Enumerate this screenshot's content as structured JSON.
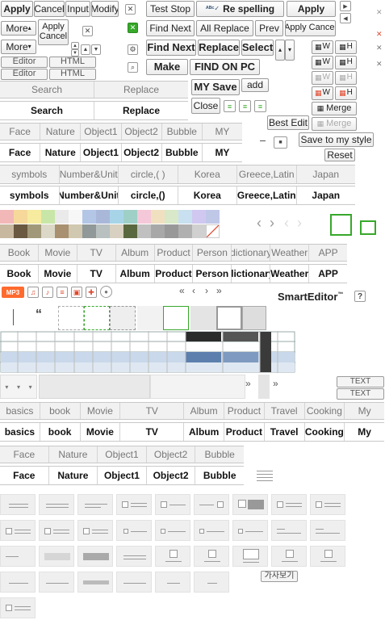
{
  "toolbar1": {
    "apply": "Apply",
    "cancel": "Cancel",
    "input": "Input",
    "modify": "Modify",
    "more": "More",
    "apply_cancel": "Apply\nCancel",
    "more2": "More",
    "editor1": "Editor",
    "html1": "HTML",
    "editor2": "Editor",
    "html2": "HTML"
  },
  "find": {
    "test_stop": "Test Stop",
    "re_spelling": "Re spelling",
    "apply": "Apply",
    "find_next": "Find Next",
    "all_replace": "All Replace",
    "prev": "Prev",
    "apply_cancel": "Apply Cancel",
    "find_next_bold": "Find Next",
    "replace": "Replace",
    "select": "Select",
    "make": "Make",
    "find_on_pc": "FIND ON PC",
    "my_save": "MY Save",
    "add": "add",
    "close": "Close"
  },
  "table_tools": {
    "w": "W",
    "h": "H",
    "merge": "Merge",
    "merge2": "Merge"
  },
  "search_replace_tabs": {
    "top": [
      "Search",
      "Replace"
    ],
    "bottom": [
      "Search",
      "Replace"
    ]
  },
  "side_buttons": {
    "best_edit": "Best Edit",
    "save_style": "Save to my style",
    "reset": "Reset"
  },
  "category_tabs_1": {
    "top": [
      "Face",
      "Nature",
      "Object1",
      "Object2",
      "Bubble",
      "MY"
    ],
    "bottom": [
      "Face",
      "Nature",
      "Object1",
      "Object2",
      "Bubble",
      "MY"
    ]
  },
  "symbol_tabs": {
    "top": [
      "symbols",
      "Number&Unit",
      "circle,( )",
      "Korea",
      "Greece,Latin",
      "Japan"
    ],
    "bottom": [
      "symbols",
      "Number&Unit",
      "circle,()",
      "Korea",
      "Greece,Latin",
      "Japan"
    ]
  },
  "media_tabs": {
    "top": [
      "Book",
      "Movie",
      "TV",
      "Album",
      "Product",
      "Person",
      "dictionary",
      "Weather",
      "APP"
    ],
    "bottom": [
      "Book",
      "Movie",
      "TV",
      "Album",
      "Product",
      "Person",
      "dictionary",
      "Weather",
      "APP"
    ]
  },
  "media_icons": [
    "mp3-icon",
    "headphone-icon",
    "music-note-icon",
    "list-icon",
    "calendar-icon",
    "plus-icon",
    "disc-icon"
  ],
  "pager": {
    "first": "«",
    "prev": "‹",
    "next": "›",
    "last": "»"
  },
  "brand": {
    "name": "SmartEditor",
    "tm": "™",
    "help": "?"
  },
  "quote_glyph": "“",
  "text_labels": {
    "text1": "TEXT",
    "text2": "TEXT"
  },
  "nav_glyphs": {
    "dbl1": "»",
    "dbl2": "»"
  },
  "shop_tabs": {
    "top": [
      "basics",
      "book",
      "Movie",
      "TV",
      "Album",
      "Product",
      "Travel",
      "Cooking",
      "My"
    ],
    "bottom": [
      "basics",
      "book",
      "Movie",
      "TV",
      "Album",
      "Product",
      "Travel",
      "Cooking",
      "My"
    ]
  },
  "category_tabs_2": {
    "top": [
      "Face",
      "Nature",
      "Object1",
      "Object2",
      "Bubble"
    ],
    "bottom": [
      "Face",
      "Nature",
      "Object1",
      "Object2",
      "Bubble"
    ]
  },
  "preview": {
    "label": "가사보기"
  },
  "colors": {
    "green": "#37a82a",
    "red": "#e0482e",
    "orange": "#ff6a2e",
    "blue_row": "#5d7fae",
    "dark_row": "#2b2b2b"
  }
}
